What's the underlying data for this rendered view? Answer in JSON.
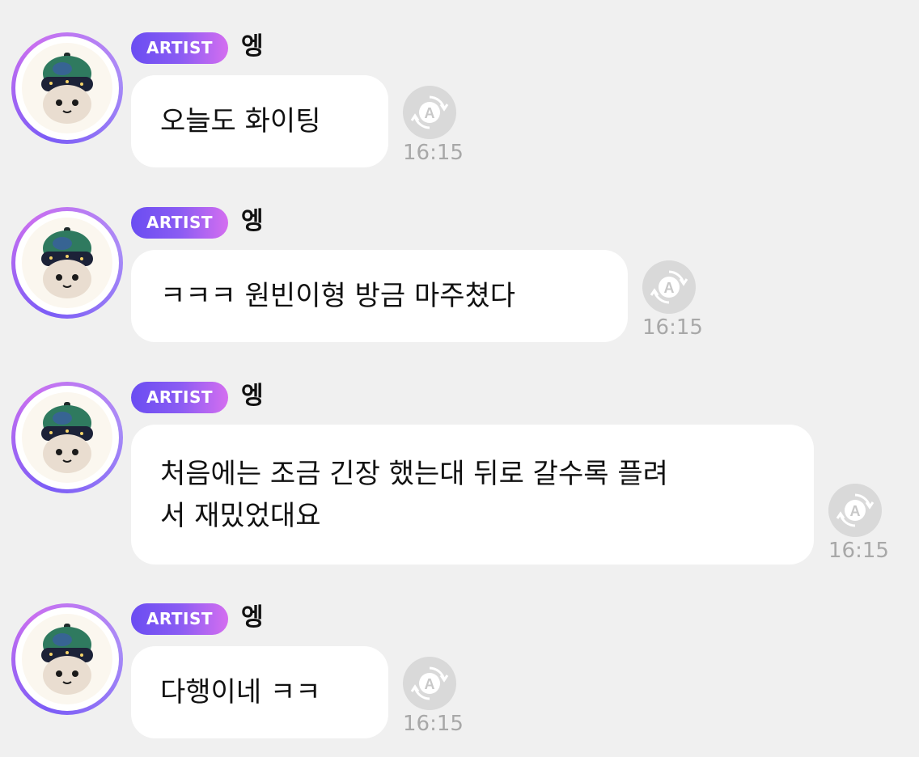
{
  "messages": [
    {
      "badge": "ARTIST",
      "sender": "엥",
      "text": "오늘도 화이팅",
      "time": "16:15",
      "translate_icon": "translate-icon"
    },
    {
      "badge": "ARTIST",
      "sender": "엥",
      "text": "ㅋㅋㅋ 원빈이형 방금 마주쳤다",
      "time": "16:15",
      "translate_icon": "translate-icon"
    },
    {
      "badge": "ARTIST",
      "sender": "엥",
      "text": "처음에는 조금 긴장 했는대 뒤로 갈수록 플려\n서 재밌었대요",
      "time": "16:15",
      "translate_icon": "translate-icon"
    },
    {
      "badge": "ARTIST",
      "sender": "엥",
      "text": "다행이네 ㅋㅋ",
      "time": "16:15",
      "translate_icon": "translate-icon"
    }
  ],
  "colors": {
    "background": "#f0f0f0",
    "bubble": "#ffffff",
    "badge_start": "#6a4df2",
    "badge_end": "#d46ef0",
    "time": "#a8a8a8"
  }
}
